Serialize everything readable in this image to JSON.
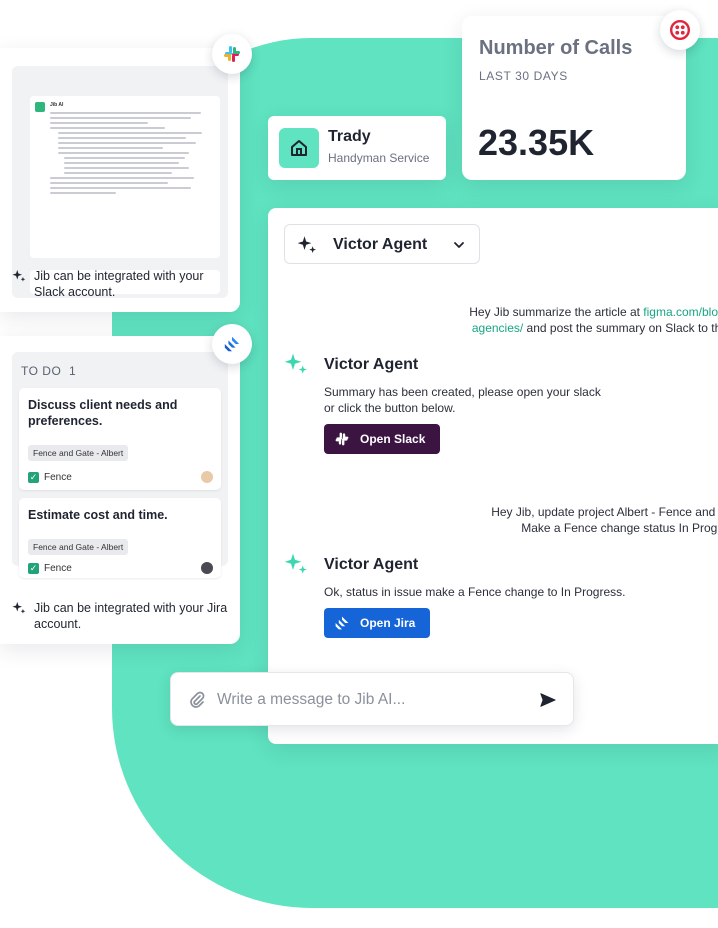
{
  "slack": {
    "integration_text": "Jib can be integrated with your Slack account.",
    "badge_icon": "slack-icon",
    "preview_name": "Jib AI"
  },
  "jira": {
    "integration_text": "Jib can be integrated with your Jira account.",
    "badge_icon": "jira-icon",
    "column_title": "TO DO",
    "column_count": "1",
    "tasks": [
      {
        "title": "Discuss client needs and preferences.",
        "tag": "Fence and Gate - Albert",
        "label": "Fence"
      },
      {
        "title": "Estimate cost and time.",
        "tag": "Fence and Gate - Albert",
        "label": "Fence"
      }
    ]
  },
  "trady": {
    "name": "Trady",
    "subtitle": "Handyman Service"
  },
  "calls": {
    "title": "Number of Calls",
    "period": "LAST 30 DAYS",
    "value": "23.35K",
    "badge_icon": "twilio-icon"
  },
  "chat": {
    "agent_selector": "Victor Agent",
    "messages": [
      {
        "line1_prefix": "Hey Jib summarize the article at ",
        "line1_link": "figma.com/blog/",
        "line2_link": "agencies/",
        "line2_suffix": " and post the summary on Slack to the"
      },
      {
        "agent": "Victor Agent",
        "line1": "Summary has been created, please open your slack",
        "line2": "or click the button below.",
        "button": "Open Slack"
      },
      {
        "line1": "Hey Jib, update project Albert - Fence and G",
        "line2": "Make a Fence change status In Progre"
      },
      {
        "agent": "Victor Agent",
        "line1": "Ok, status in issue make a Fence change to In Progress.",
        "button": "Open Jira"
      }
    ],
    "input_placeholder": "Write a message to Jib AI..."
  },
  "colors": {
    "accent": "#5fe3c0",
    "slack_button": "#3b1442",
    "jira_button": "#1565d8",
    "link": "#17a684"
  }
}
